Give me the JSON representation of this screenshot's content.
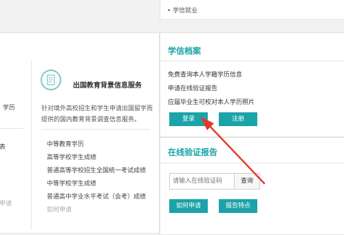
{
  "top_right_item": "• 学信就业",
  "left": {
    "cut_text_1": "学历",
    "cut_text_2": "表",
    "cut_text_3": "申请"
  },
  "study_abroad": {
    "title": "出国教育背景信息服务",
    "desc_line1": "针对境外高校招生和学生申请出国留学而",
    "desc_line2": "提供的国内教育背景调查信息服务。",
    "links": [
      "中等教育学历",
      "高等学校学生成绩",
      "普通高等学校招生全国统一考试成绩",
      "中等学校学生成绩",
      "普通高中学业水平考试（会考）成绩",
      "如何申请"
    ]
  },
  "xuexin_archive": {
    "title": "学信档案",
    "items": [
      "免费查询本人学籍学历信息",
      "申请在线验证报告",
      "应届毕业生可校对本人学历照片"
    ],
    "login_label": "登录",
    "register_label": "注册"
  },
  "online_report": {
    "title": "在线验证报告",
    "input_placeholder": "请输入在线验证码",
    "query_label": "查询",
    "how_to_apply_label": "如何申请",
    "report_features_label": "报告特点"
  },
  "colors": {
    "accent": "#1aa3a8",
    "arrow": "#e23b2e"
  }
}
